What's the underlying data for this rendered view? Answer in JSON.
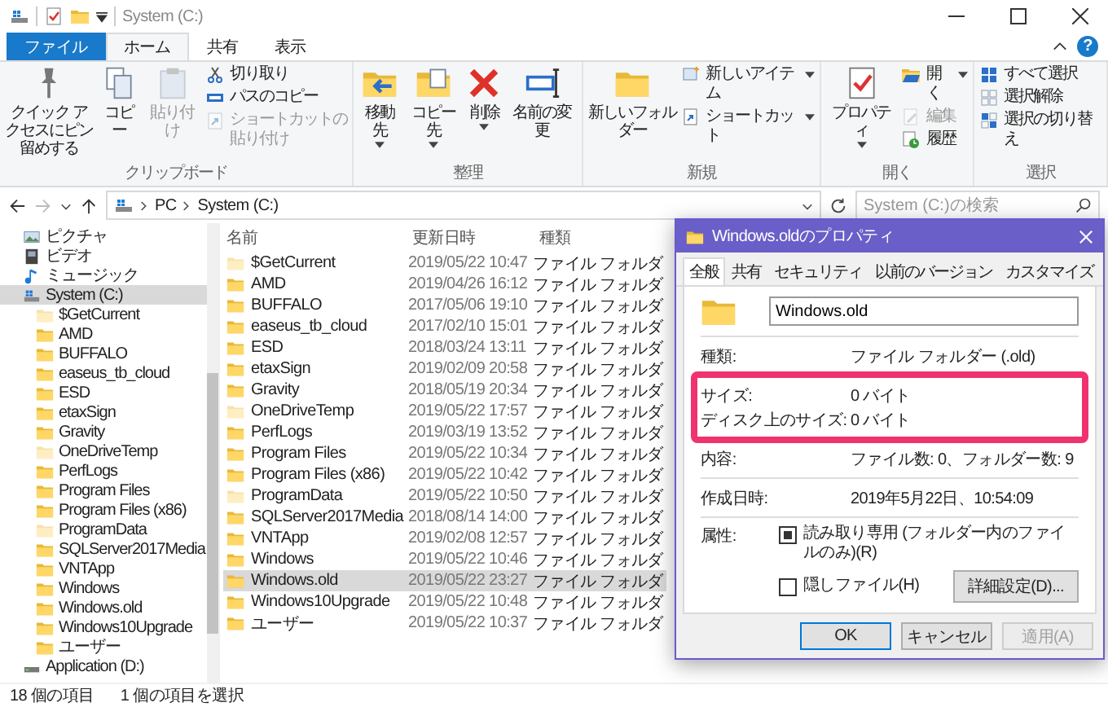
{
  "window": {
    "title": "System (C:)"
  },
  "ribbon": {
    "tabs": [
      {
        "label": "ファイル",
        "kind": "file",
        "selected": false
      },
      {
        "label": "ホーム",
        "kind": "tab",
        "selected": true
      },
      {
        "label": "共有",
        "kind": "tab",
        "selected": false
      },
      {
        "label": "表示",
        "kind": "tab",
        "selected": false
      }
    ],
    "help": "?",
    "groups": [
      {
        "label": "クリップボード",
        "items": [
          {
            "kind": "large",
            "label": "クイック アクセスにピン留めする",
            "disabled": false,
            "menu": false
          },
          {
            "kind": "large",
            "label": "コピー",
            "disabled": false,
            "menu": false
          },
          {
            "kind": "large",
            "label": "貼り付け",
            "disabled": true,
            "menu": false
          },
          {
            "kind": "small",
            "label": "切り取り",
            "disabled": false,
            "menu": false
          },
          {
            "kind": "small",
            "label": "パスのコピー",
            "disabled": false,
            "menu": false
          },
          {
            "kind": "small",
            "label": "ショートカットの貼り付け",
            "disabled": true,
            "menu": false
          }
        ]
      },
      {
        "label": "整理",
        "items": [
          {
            "kind": "large",
            "label": "移動先",
            "disabled": false,
            "menu": true
          },
          {
            "kind": "large",
            "label": "コピー先",
            "disabled": false,
            "menu": true
          },
          {
            "kind": "large",
            "label": "削除",
            "disabled": false,
            "menu": true
          },
          {
            "kind": "large",
            "label": "名前の変更",
            "disabled": false,
            "menu": false
          }
        ]
      },
      {
        "label": "新規",
        "items": [
          {
            "kind": "large",
            "label": "新しいフォルダー",
            "disabled": false,
            "menu": false
          },
          {
            "kind": "small",
            "label": "新しいアイテム",
            "disabled": false,
            "menu": true
          },
          {
            "kind": "small",
            "label": "ショートカット",
            "disabled": false,
            "menu": true
          }
        ]
      },
      {
        "label": "開く",
        "items": [
          {
            "kind": "large",
            "label": "プロパティ",
            "disabled": false,
            "menu": true
          },
          {
            "kind": "small",
            "label": "開く",
            "disabled": false,
            "menu": true
          },
          {
            "kind": "small",
            "label": "編集",
            "disabled": true,
            "menu": false
          },
          {
            "kind": "small",
            "label": "履歴",
            "disabled": false,
            "menu": false
          }
        ]
      },
      {
        "label": "選択",
        "items": [
          {
            "kind": "small",
            "label": "すべて選択",
            "disabled": false,
            "menu": false
          },
          {
            "kind": "small",
            "label": "選択解除",
            "disabled": false,
            "menu": false
          },
          {
            "kind": "small",
            "label": "選択の切り替え",
            "disabled": false,
            "menu": false
          }
        ]
      }
    ]
  },
  "address": {
    "crumbs": [
      "PC",
      "System (C:)"
    ],
    "search_placeholder": "System (C:)の検索"
  },
  "navigation": {
    "items": [
      {
        "label": "ピクチャ",
        "kind": "pictures",
        "selected": false
      },
      {
        "label": "ビデオ",
        "kind": "video",
        "selected": false
      },
      {
        "label": "ミュージック",
        "kind": "music",
        "selected": false
      },
      {
        "label": "System (C:)",
        "kind": "system-drive",
        "selected": true,
        "children": [
          {
            "label": "$GetCurrent",
            "hidden": true,
            "selected": false
          },
          {
            "label": "AMD",
            "hidden": false,
            "selected": false
          },
          {
            "label": "BUFFALO",
            "hidden": false,
            "selected": false
          },
          {
            "label": "easeus_tb_cloud",
            "hidden": false,
            "selected": false
          },
          {
            "label": "ESD",
            "hidden": false,
            "selected": false
          },
          {
            "label": "etaxSign",
            "hidden": false,
            "selected": false
          },
          {
            "label": "Gravity",
            "hidden": false,
            "selected": false
          },
          {
            "label": "OneDriveTemp",
            "hidden": true,
            "selected": false
          },
          {
            "label": "PerfLogs",
            "hidden": false,
            "selected": false
          },
          {
            "label": "Program Files",
            "hidden": false,
            "selected": false
          },
          {
            "label": "Program Files (x86)",
            "hidden": false,
            "selected": false
          },
          {
            "label": "ProgramData",
            "hidden": true,
            "selected": false
          },
          {
            "label": "SQLServer2017Media",
            "hidden": false,
            "selected": false
          },
          {
            "label": "VNTApp",
            "hidden": false,
            "selected": false
          },
          {
            "label": "Windows",
            "hidden": false,
            "selected": false
          },
          {
            "label": "Windows.old",
            "hidden": false,
            "selected": false
          },
          {
            "label": "Windows10Upgrade",
            "hidden": false,
            "selected": false
          },
          {
            "label": "ユーザー",
            "hidden": false,
            "selected": false
          }
        ]
      },
      {
        "label": "Application (D:)",
        "kind": "drive",
        "selected": false
      }
    ]
  },
  "file_list": {
    "columns": [
      "名前",
      "更新日時",
      "種類"
    ],
    "rows": [
      {
        "name": "$GetCurrent",
        "date": "2019/05/22 10:47",
        "type": "ファイル フォルダ",
        "hidden": true,
        "selected": false
      },
      {
        "name": "AMD",
        "date": "2019/04/26 16:12",
        "type": "ファイル フォルダ",
        "hidden": false,
        "selected": false
      },
      {
        "name": "BUFFALO",
        "date": "2017/05/06 19:10",
        "type": "ファイル フォルダ",
        "hidden": false,
        "selected": false
      },
      {
        "name": "easeus_tb_cloud",
        "date": "2017/02/10 15:01",
        "type": "ファイル フォルダ",
        "hidden": false,
        "selected": false
      },
      {
        "name": "ESD",
        "date": "2018/03/24 13:11",
        "type": "ファイル フォルダ",
        "hidden": false,
        "selected": false
      },
      {
        "name": "etaxSign",
        "date": "2019/02/09 20:58",
        "type": "ファイル フォルダ",
        "hidden": false,
        "selected": false
      },
      {
        "name": "Gravity",
        "date": "2018/05/19 20:34",
        "type": "ファイル フォルダ",
        "hidden": false,
        "selected": false
      },
      {
        "name": "OneDriveTemp",
        "date": "2019/05/22 17:57",
        "type": "ファイル フォルダ",
        "hidden": true,
        "selected": false
      },
      {
        "name": "PerfLogs",
        "date": "2019/03/19 13:52",
        "type": "ファイル フォルダ",
        "hidden": false,
        "selected": false
      },
      {
        "name": "Program Files",
        "date": "2019/05/22 10:34",
        "type": "ファイル フォルダ",
        "hidden": false,
        "selected": false
      },
      {
        "name": "Program Files (x86)",
        "date": "2019/05/22 10:42",
        "type": "ファイル フォルダ",
        "hidden": false,
        "selected": false
      },
      {
        "name": "ProgramData",
        "date": "2019/05/22 10:50",
        "type": "ファイル フォルダ",
        "hidden": true,
        "selected": false
      },
      {
        "name": "SQLServer2017Media",
        "date": "2018/08/14 14:00",
        "type": "ファイル フォルダ",
        "hidden": false,
        "selected": false
      },
      {
        "name": "VNTApp",
        "date": "2019/02/08 12:57",
        "type": "ファイル フォルダ",
        "hidden": false,
        "selected": false
      },
      {
        "name": "Windows",
        "date": "2019/05/22 10:46",
        "type": "ファイル フォルダ",
        "hidden": false,
        "selected": false
      },
      {
        "name": "Windows.old",
        "date": "2019/05/22 23:27",
        "type": "ファイル フォルダ",
        "hidden": false,
        "selected": true
      },
      {
        "name": "Windows10Upgrade",
        "date": "2019/05/22 10:48",
        "type": "ファイル フォルダ",
        "hidden": false,
        "selected": false
      },
      {
        "name": "ユーザー",
        "date": "2019/05/22 10:37",
        "type": "ファイル フォルダ",
        "hidden": false,
        "selected": false
      }
    ]
  },
  "status_bar": [
    "18 個の項目",
    "1 個の項目を選択"
  ],
  "dialog": {
    "title": "Windows.oldのプロパティ",
    "tabs": [
      {
        "label": "全般",
        "selected": true
      },
      {
        "label": "共有",
        "selected": false
      },
      {
        "label": "セキュリティ",
        "selected": false
      },
      {
        "label": "以前のバージョン",
        "selected": false
      },
      {
        "label": "カスタマイズ",
        "selected": false
      }
    ],
    "name": "Windows.old",
    "sections": [
      [
        {
          "kind": "rows",
          "rows": [
            {
              "label": "種類:",
              "value": "ファイル フォルダー (.old)"
            }
          ]
        },
        {
          "kind": "highlight",
          "rows": [
            {
              "label": "サイズ:",
              "value": "0 バイト"
            },
            {
              "label": "ディスク上のサイズ:",
              "value": "0 バイト"
            }
          ]
        },
        {
          "kind": "rows",
          "rows": [
            {
              "label": "内容:",
              "value": "ファイル数: 0、フォルダー数: 9"
            }
          ]
        }
      ],
      [
        {
          "kind": "rows",
          "rows": [
            {
              "label": "作成日時:",
              "value": "2019年5月22日、10:54:09"
            }
          ]
        }
      ]
    ],
    "attributes": {
      "label": "属性:",
      "checks": [
        {
          "label": "読み取り専用 (フォルダー内のファイルのみ)(R)",
          "checked": true
        },
        {
          "label": "隠しファイル(H)",
          "checked": false
        }
      ],
      "button": "詳細設定(D)..."
    },
    "buttons": [
      {
        "label": "OK",
        "kind": "default",
        "disabled": false
      },
      {
        "label": "キャンセル",
        "kind": "normal",
        "disabled": false
      },
      {
        "label": "適用(A)",
        "kind": "normal",
        "disabled": true
      }
    ]
  }
}
